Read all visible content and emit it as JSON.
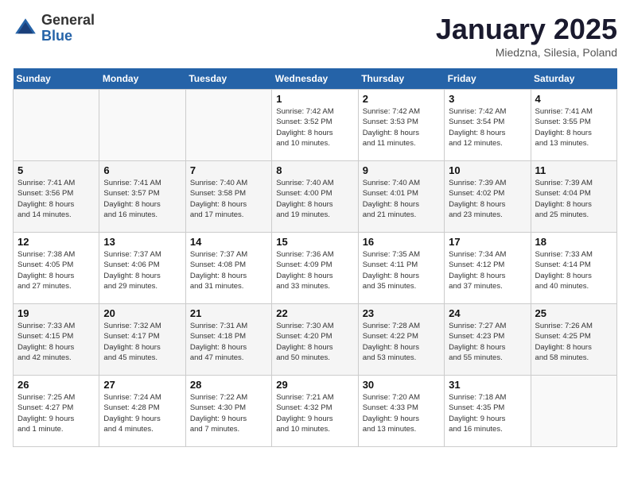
{
  "header": {
    "logo_general": "General",
    "logo_blue": "Blue",
    "month_title": "January 2025",
    "subtitle": "Miedzna, Silesia, Poland"
  },
  "weekdays": [
    "Sunday",
    "Monday",
    "Tuesday",
    "Wednesday",
    "Thursday",
    "Friday",
    "Saturday"
  ],
  "weeks": [
    [
      {
        "day": "",
        "info": ""
      },
      {
        "day": "",
        "info": ""
      },
      {
        "day": "",
        "info": ""
      },
      {
        "day": "1",
        "info": "Sunrise: 7:42 AM\nSunset: 3:52 PM\nDaylight: 8 hours\nand 10 minutes."
      },
      {
        "day": "2",
        "info": "Sunrise: 7:42 AM\nSunset: 3:53 PM\nDaylight: 8 hours\nand 11 minutes."
      },
      {
        "day": "3",
        "info": "Sunrise: 7:42 AM\nSunset: 3:54 PM\nDaylight: 8 hours\nand 12 minutes."
      },
      {
        "day": "4",
        "info": "Sunrise: 7:41 AM\nSunset: 3:55 PM\nDaylight: 8 hours\nand 13 minutes."
      }
    ],
    [
      {
        "day": "5",
        "info": "Sunrise: 7:41 AM\nSunset: 3:56 PM\nDaylight: 8 hours\nand 14 minutes."
      },
      {
        "day": "6",
        "info": "Sunrise: 7:41 AM\nSunset: 3:57 PM\nDaylight: 8 hours\nand 16 minutes."
      },
      {
        "day": "7",
        "info": "Sunrise: 7:40 AM\nSunset: 3:58 PM\nDaylight: 8 hours\nand 17 minutes."
      },
      {
        "day": "8",
        "info": "Sunrise: 7:40 AM\nSunset: 4:00 PM\nDaylight: 8 hours\nand 19 minutes."
      },
      {
        "day": "9",
        "info": "Sunrise: 7:40 AM\nSunset: 4:01 PM\nDaylight: 8 hours\nand 21 minutes."
      },
      {
        "day": "10",
        "info": "Sunrise: 7:39 AM\nSunset: 4:02 PM\nDaylight: 8 hours\nand 23 minutes."
      },
      {
        "day": "11",
        "info": "Sunrise: 7:39 AM\nSunset: 4:04 PM\nDaylight: 8 hours\nand 25 minutes."
      }
    ],
    [
      {
        "day": "12",
        "info": "Sunrise: 7:38 AM\nSunset: 4:05 PM\nDaylight: 8 hours\nand 27 minutes."
      },
      {
        "day": "13",
        "info": "Sunrise: 7:37 AM\nSunset: 4:06 PM\nDaylight: 8 hours\nand 29 minutes."
      },
      {
        "day": "14",
        "info": "Sunrise: 7:37 AM\nSunset: 4:08 PM\nDaylight: 8 hours\nand 31 minutes."
      },
      {
        "day": "15",
        "info": "Sunrise: 7:36 AM\nSunset: 4:09 PM\nDaylight: 8 hours\nand 33 minutes."
      },
      {
        "day": "16",
        "info": "Sunrise: 7:35 AM\nSunset: 4:11 PM\nDaylight: 8 hours\nand 35 minutes."
      },
      {
        "day": "17",
        "info": "Sunrise: 7:34 AM\nSunset: 4:12 PM\nDaylight: 8 hours\nand 37 minutes."
      },
      {
        "day": "18",
        "info": "Sunrise: 7:33 AM\nSunset: 4:14 PM\nDaylight: 8 hours\nand 40 minutes."
      }
    ],
    [
      {
        "day": "19",
        "info": "Sunrise: 7:33 AM\nSunset: 4:15 PM\nDaylight: 8 hours\nand 42 minutes."
      },
      {
        "day": "20",
        "info": "Sunrise: 7:32 AM\nSunset: 4:17 PM\nDaylight: 8 hours\nand 45 minutes."
      },
      {
        "day": "21",
        "info": "Sunrise: 7:31 AM\nSunset: 4:18 PM\nDaylight: 8 hours\nand 47 minutes."
      },
      {
        "day": "22",
        "info": "Sunrise: 7:30 AM\nSunset: 4:20 PM\nDaylight: 8 hours\nand 50 minutes."
      },
      {
        "day": "23",
        "info": "Sunrise: 7:28 AM\nSunset: 4:22 PM\nDaylight: 8 hours\nand 53 minutes."
      },
      {
        "day": "24",
        "info": "Sunrise: 7:27 AM\nSunset: 4:23 PM\nDaylight: 8 hours\nand 55 minutes."
      },
      {
        "day": "25",
        "info": "Sunrise: 7:26 AM\nSunset: 4:25 PM\nDaylight: 8 hours\nand 58 minutes."
      }
    ],
    [
      {
        "day": "26",
        "info": "Sunrise: 7:25 AM\nSunset: 4:27 PM\nDaylight: 9 hours\nand 1 minute."
      },
      {
        "day": "27",
        "info": "Sunrise: 7:24 AM\nSunset: 4:28 PM\nDaylight: 9 hours\nand 4 minutes."
      },
      {
        "day": "28",
        "info": "Sunrise: 7:22 AM\nSunset: 4:30 PM\nDaylight: 9 hours\nand 7 minutes."
      },
      {
        "day": "29",
        "info": "Sunrise: 7:21 AM\nSunset: 4:32 PM\nDaylight: 9 hours\nand 10 minutes."
      },
      {
        "day": "30",
        "info": "Sunrise: 7:20 AM\nSunset: 4:33 PM\nDaylight: 9 hours\nand 13 minutes."
      },
      {
        "day": "31",
        "info": "Sunrise: 7:18 AM\nSunset: 4:35 PM\nDaylight: 9 hours\nand 16 minutes."
      },
      {
        "day": "",
        "info": ""
      }
    ]
  ]
}
